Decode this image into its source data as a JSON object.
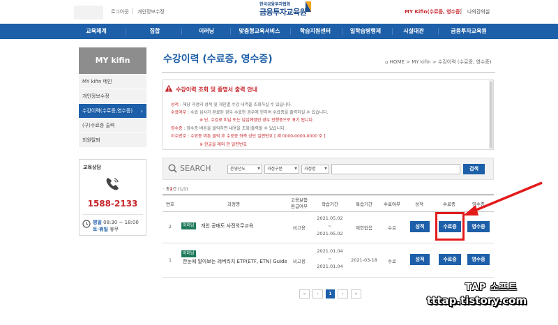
{
  "top": {
    "logout": "로그아웃",
    "edit_profile": "개인정보수정",
    "brand_sub": "한국금융투자협회",
    "brand_main": "금융투자교육원",
    "user": "MY Kifin(수료증, 영수증)",
    "my_room": "나의강의실"
  },
  "nav": [
    "교육체계",
    "집합",
    "이러닝",
    "맞춤형교육서비스",
    "학습지원센터",
    "일학습병행제",
    "시설대관",
    "금융투자교육원"
  ],
  "sidebar": {
    "title": "MY kifin",
    "items": [
      {
        "label": "MY kifin 메인",
        "active": false
      },
      {
        "label": "개인정보수정",
        "active": false
      },
      {
        "label": "수강이력(수료증,영수증)",
        "active": true
      },
      {
        "label": "(구)수료증 출력",
        "active": false
      },
      {
        "label": "회원탈퇴",
        "active": false
      }
    ],
    "consult_title": "교육상담",
    "phone": "1588-2133",
    "hours_weekday_label": "평일",
    "hours_weekday": "08:30 ~ 18:00",
    "hours_holiday_label": "토·휴일",
    "hours_holiday": "휴무"
  },
  "page": {
    "title": "수강이력 (수료증, 영수증)",
    "breadcrumb": "HOME > MY kifin > 수강이력 (수료증, 영수증)"
  },
  "notice": {
    "heading": "수강이력 조회 및 증명서 출력 안내",
    "lines": [
      {
        "key": "성적",
        "text": " : 해당 과정의 성적 및 개인별 수강 내역을 조회하실 수 있습니다.",
        "red": false
      },
      {
        "key": "수료여부",
        "text": " : 수료 심사가 완료된 경우 수료한 경우에 한하여 수료증을 출력하실 수 있습니다.",
        "red": false
      },
      {
        "key": "",
        "text": "※ 단, 수강료 미납 또는 납입예정인 경우 진행중으로 표기 됩니다.",
        "red": true
      },
      {
        "key": "영수증",
        "text": " : 영수증 버튼을 클릭하면 내용을 조회/출력할 수 있습니다.",
        "red": false
      },
      {
        "key": "이수번호",
        "text": " : 수료증 버튼 클릭 후 수료증 좌측 상단 일련번호 [ 제 0000-0000-0000 호 ]",
        "red": true
      },
      {
        "key": "",
        "text": "※ 한글을 제외 한 일련번호",
        "red": true
      }
    ]
  },
  "search": {
    "label": "SEARCH",
    "selects": [
      "운영년도",
      "과정구분",
      "과정명"
    ],
    "input_value": "",
    "button": "검색"
  },
  "total": {
    "prefix": "· 총",
    "count": "2",
    "suffix": "건 (1/1)"
  },
  "table": {
    "headers": [
      "번호",
      "과정명",
      "고용보험\n환급여부",
      "학습기간",
      "복습기간",
      "수료여부",
      "성적",
      "수료증",
      "영수증"
    ],
    "rows": [
      {
        "no": "2",
        "tag": "이러닝",
        "course": "개인 공매도 사전의무교육",
        "refund": "비고용",
        "period_start": "2021.05.02",
        "period_sep": "~",
        "period_end": "2021.05.02",
        "review": "제한없음",
        "status": "수료",
        "grade_btn": "성적",
        "cert_btn": "수료증",
        "receipt_btn": "영수증"
      },
      {
        "no": "1",
        "tag": "이러닝",
        "course": "한눈에 알아보는 레버리지 ETP(ETF, ETN) Guide",
        "refund": "비고용",
        "period_start": "2021.01.04",
        "period_sep": "~",
        "period_end": "2021.01.04",
        "review": "2021-03-18",
        "status": "수료",
        "grade_btn": "성적",
        "cert_btn": "수료증",
        "receipt_btn": "영수증"
      }
    ]
  },
  "pagination": {
    "first": "«",
    "prev": "‹",
    "current": "1",
    "next": "›",
    "last": "»"
  },
  "watermark": {
    "line1": "TAP 소프트",
    "line2": "tttap.tistory.com"
  },
  "colors": {
    "primary": "#1d5fa8",
    "alert": "#c7252b",
    "highlight": "#e31a1a"
  }
}
